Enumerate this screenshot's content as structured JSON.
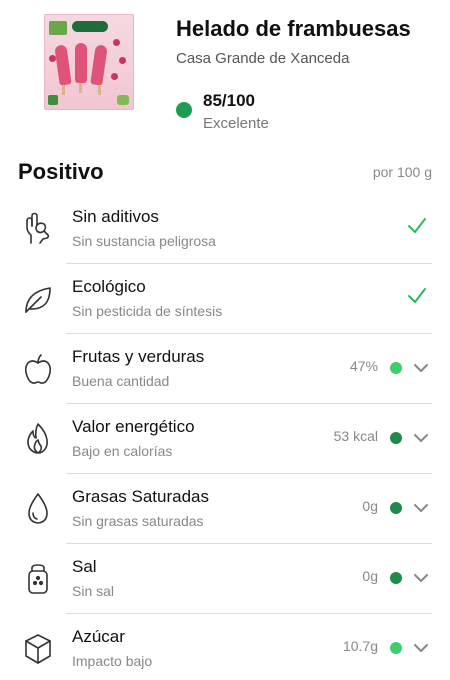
{
  "product": {
    "title": "Helado de frambuesas",
    "brand": "Casa Grande de Xanceda",
    "score": "85/100",
    "score_label": "Excelente"
  },
  "section": {
    "title": "Positivo",
    "note": "por 100 g"
  },
  "colors": {
    "score": "#1e9e52",
    "check": "#2eb85c",
    "light_green": "#3ecf6b",
    "dark_green": "#1f8a4c"
  },
  "items": [
    {
      "icon": "hand-ok-icon",
      "label": "Sin aditivos",
      "sub": "Sin sustancia peligrosa",
      "kind": "check"
    },
    {
      "icon": "leaf-icon",
      "label": "Ecológico",
      "sub": "Sin pesticida de síntesis",
      "kind": "check"
    },
    {
      "icon": "apple-icon",
      "label": "Frutas y verduras",
      "sub": "Buena cantidad",
      "kind": "value",
      "value": "47%",
      "dot_color": "#3ecf6b"
    },
    {
      "icon": "flame-icon",
      "label": "Valor energético",
      "sub": "Bajo en calorías",
      "kind": "value",
      "value": "53 kcal",
      "dot_color": "#1f8a4c"
    },
    {
      "icon": "drop-icon",
      "label": "Grasas Saturadas",
      "sub": "Sin grasas saturadas",
      "kind": "value",
      "value": "0g",
      "dot_color": "#1f8a4c"
    },
    {
      "icon": "salt-shaker-icon",
      "label": "Sal",
      "sub": "Sin sal",
      "kind": "value",
      "value": "0g",
      "dot_color": "#1f8a4c"
    },
    {
      "icon": "sugar-cube-icon",
      "label": "Azúcar",
      "sub": "Impacto bajo",
      "kind": "value",
      "value": "10.7g",
      "dot_color": "#3ecf6b"
    }
  ]
}
